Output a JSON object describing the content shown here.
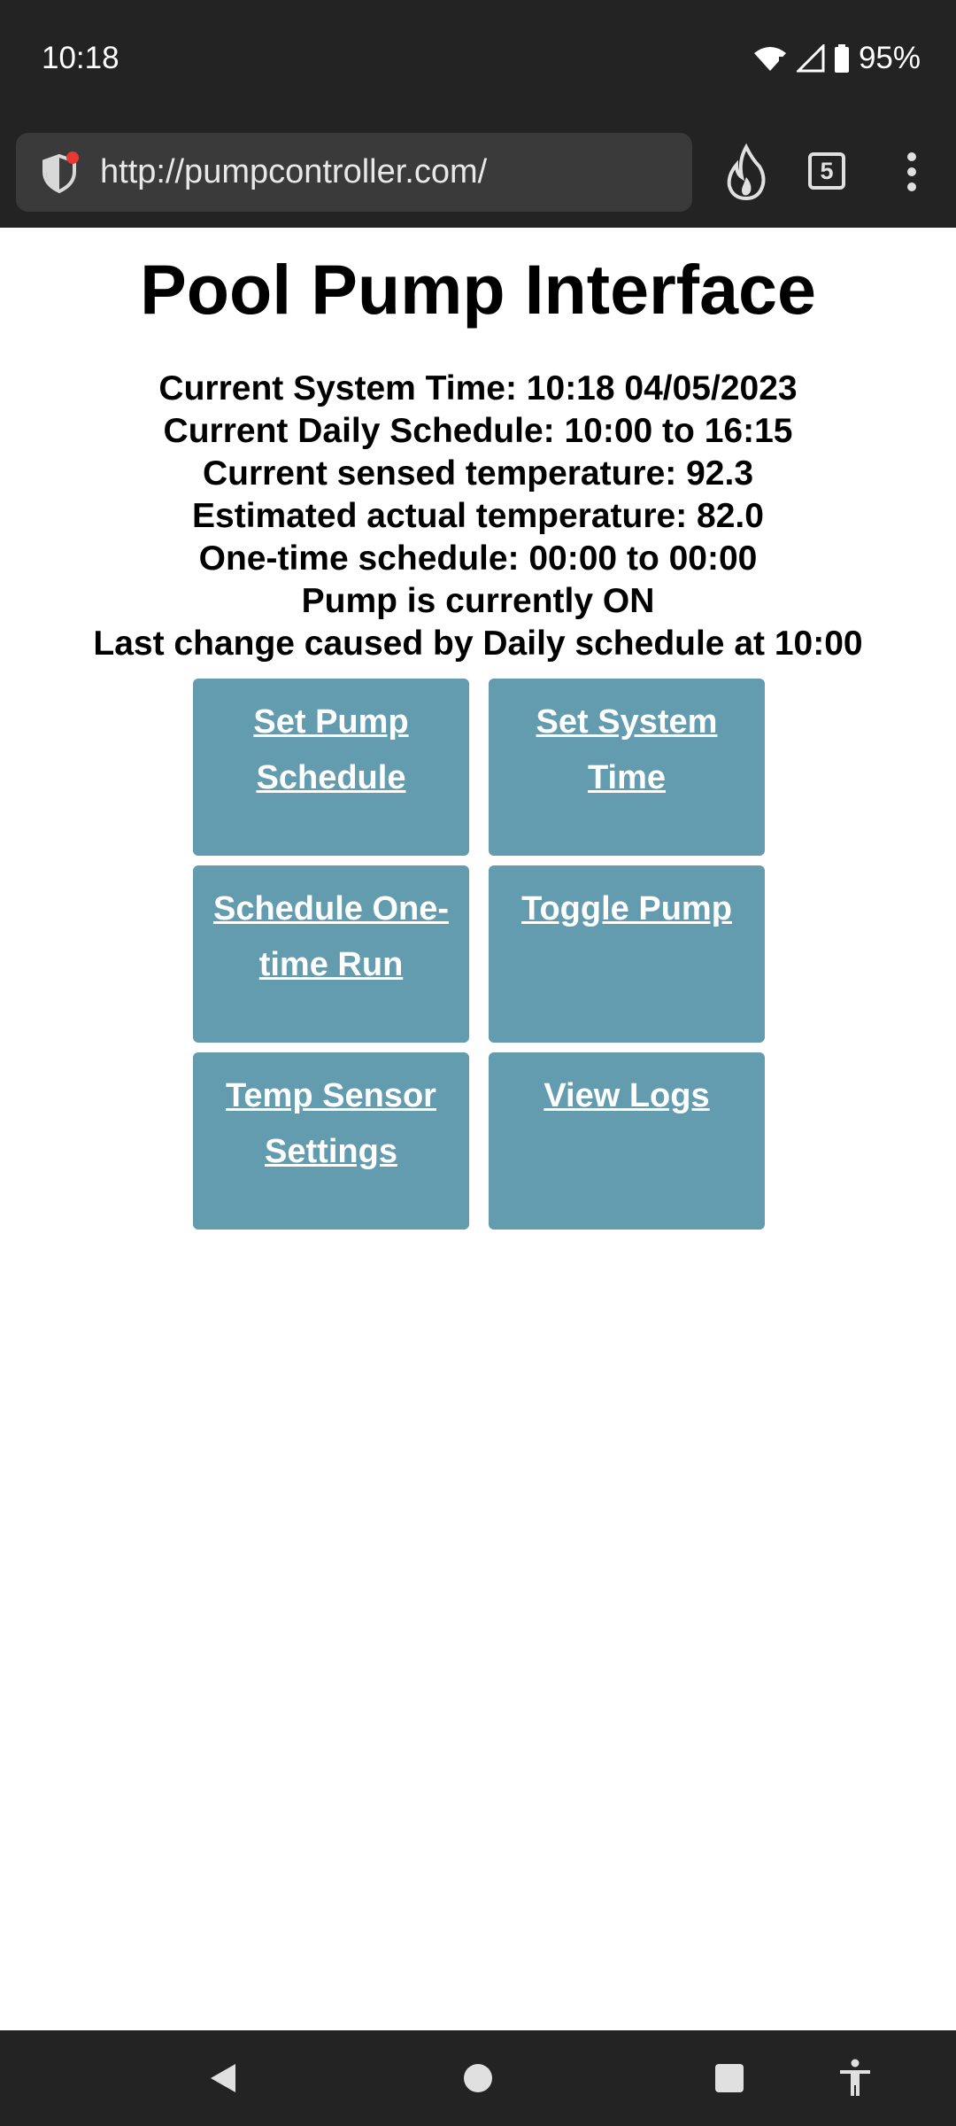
{
  "status_bar": {
    "time": "10:18",
    "battery": "95%"
  },
  "browser": {
    "url": "http://pumpcontroller.com/",
    "tab_count": "5"
  },
  "page": {
    "title": "Pool Pump Interface",
    "info": [
      "Current System Time: 10:18 04/05/2023",
      "Current Daily Schedule: 10:00 to 16:15",
      "Current sensed temperature: 92.3",
      "Estimated actual temperature: 82.0",
      "One-time schedule: 00:00 to 00:00",
      "Pump is currently ON",
      "Last change caused by Daily schedule at 10:00"
    ],
    "buttons": [
      {
        "label": "Set Pump Schedule"
      },
      {
        "label": "Set System Time"
      },
      {
        "label": "Schedule One-time Run"
      },
      {
        "label": "Toggle Pump"
      },
      {
        "label": "Temp Sensor Settings"
      },
      {
        "label": "View Logs"
      }
    ]
  },
  "colors": {
    "tile": "#639baf",
    "chrome": "#232323"
  },
  "icons": {
    "shield": "tracking-protection-shield-icon",
    "flame": "fire-icon",
    "menu": "kebab-menu-icon",
    "back": "back-triangle-icon",
    "home": "home-circle-icon",
    "recents": "recents-square-icon",
    "accessibility": "accessibility-icon"
  }
}
